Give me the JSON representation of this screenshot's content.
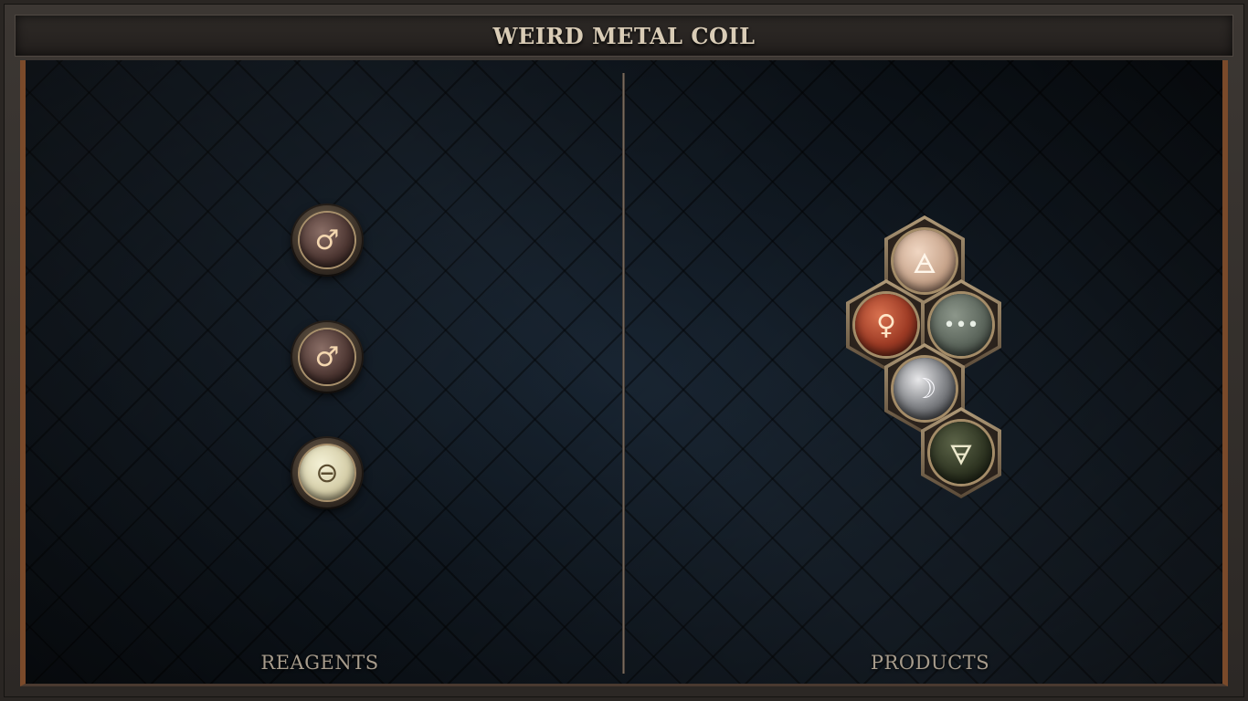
{
  "title": "WEIRD METAL COIL",
  "sections": {
    "reagents_label": "REAGENTS",
    "products_label": "PRODUCTS"
  },
  "reagents": [
    {
      "symbol": "♂",
      "element": "iron",
      "icon": "iron-icon"
    },
    {
      "symbol": "♂",
      "element": "iron",
      "icon": "iron-icon"
    },
    {
      "symbol": "⊖",
      "element": "salt",
      "icon": "salt-icon"
    }
  ],
  "product": {
    "atoms": [
      {
        "symbol": "🜁",
        "element": "air",
        "icon": "air-icon"
      },
      {
        "symbol": "♀",
        "element": "copper",
        "icon": "copper-icon"
      },
      {
        "symbol": "•••",
        "element": "unknown",
        "icon": "ellipsis-icon"
      },
      {
        "symbol": "☽",
        "element": "silver",
        "icon": "silver-moon-icon"
      },
      {
        "symbol": "🜃",
        "element": "earth",
        "icon": "earth-icon"
      }
    ]
  },
  "colors": {
    "background": "#17222e",
    "frame": "#2c2825",
    "accent_copper": "#7a4a2a",
    "title_text": "#d9ccb6",
    "label_text": "#a79c8c"
  }
}
